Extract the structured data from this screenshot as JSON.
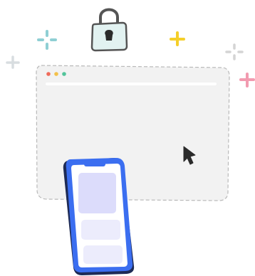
{
  "illustration": {
    "subject": "secure-browsing-lock-browser-phone",
    "colors": {
      "lock_fill": "#e2f2f1",
      "lock_stroke": "#555555",
      "lock_keyhole": "#2b2b2b",
      "browser_fill": "#f2f2f2",
      "browser_bar": "#ffffff",
      "dot_red": "#ef6b5a",
      "dot_yellow": "#f3c14a",
      "dot_green": "#52c49a",
      "phone_blue": "#3b6ef0",
      "phone_dark": "#1d2a55",
      "phone_screen": "#ffffff",
      "phone_card_primary": "#dcdcfb",
      "phone_card_secondary": "#ececfc",
      "cursor": "#2a2a2a",
      "sparkle_teal": "#8fcfd4",
      "sparkle_yellow": "#f5cf2a",
      "sparkle_pink": "#f29bb0",
      "sparkle_gray": "#d4d4d4"
    },
    "icons": {
      "lock": "padlock-icon",
      "cursor": "mouse-pointer-icon",
      "sparkles": "sparkle-icon"
    }
  }
}
